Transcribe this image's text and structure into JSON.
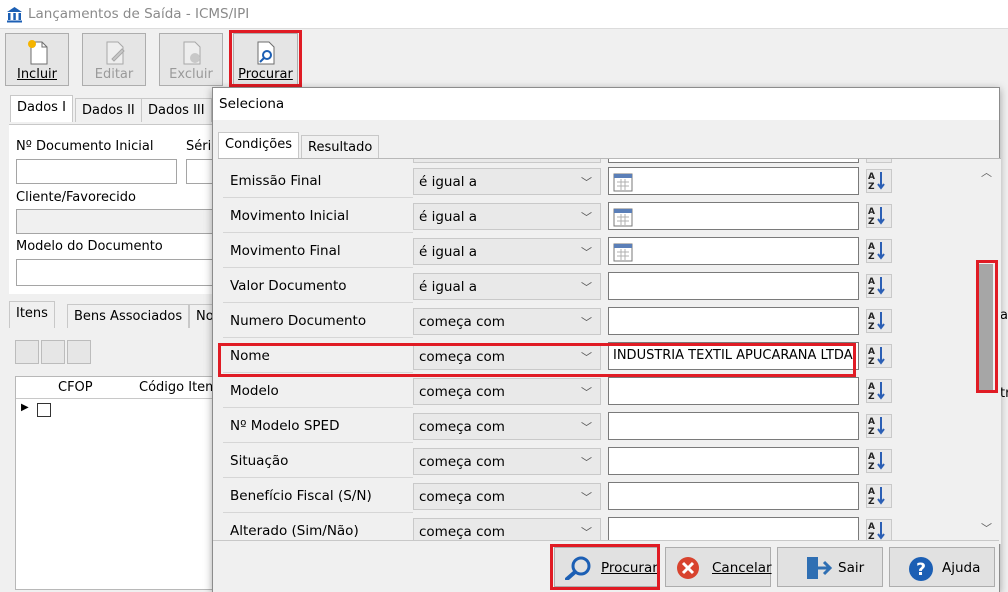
{
  "window": {
    "title": "Lançamentos de Saída - ICMS/IPI"
  },
  "toolbar": {
    "incluir": "Incluir",
    "editar": "Editar",
    "excluir": "Excluir",
    "procurar": "Procurar"
  },
  "tabs_top": [
    "Dados I",
    "Dados II",
    "Dados III"
  ],
  "form": {
    "doc_inicial_label": "Nº Documento Inicial",
    "serie_label": "Séri",
    "cliente_label": "Cliente/Favorecido",
    "modelo_label": "Modelo do Documento"
  },
  "tabs_bottom": [
    "Itens",
    "Bens Associados",
    "No"
  ],
  "items_table": {
    "col_cfop": "CFOP",
    "col_codigo": "Código Item",
    "right_label": "tr"
  },
  "right_tab_label": "ac",
  "dialog": {
    "title": "Seleciona",
    "tabs": [
      "Condições",
      "Resultado"
    ],
    "rows": [
      {
        "name": "Emissão Final",
        "cond": "é igual a",
        "value": "",
        "calendar": true
      },
      {
        "name": "Movimento Inicial",
        "cond": "é igual a",
        "value": "",
        "calendar": true
      },
      {
        "name": "Movimento Final",
        "cond": "é igual a",
        "value": "",
        "calendar": true
      },
      {
        "name": "Valor Documento",
        "cond": "é igual a",
        "value": "",
        "calendar": false
      },
      {
        "name": "Numero Documento",
        "cond": "começa com",
        "value": "",
        "calendar": false
      },
      {
        "name": "Nome",
        "cond": "começa com",
        "value": "INDUSTRIA TEXTIL APUCARANA LTDA.",
        "calendar": false
      },
      {
        "name": "Modelo",
        "cond": "começa com",
        "value": "",
        "calendar": false
      },
      {
        "name": "Nº Modelo SPED",
        "cond": "começa com",
        "value": "",
        "calendar": false
      },
      {
        "name": "Situação",
        "cond": "começa com",
        "value": "",
        "calendar": false
      },
      {
        "name": "Benefício Fiscal (S/N)",
        "cond": "começa com",
        "value": "",
        "calendar": false
      },
      {
        "name": "Alterado (Sim/Não)",
        "cond": "começa com",
        "value": "",
        "calendar": false
      }
    ],
    "buttons": {
      "procurar": "Procurar",
      "cancelar": "Cancelar",
      "sair": "Sair",
      "ajuda": "Ajuda"
    }
  },
  "colors": {
    "highlight": "#e01b24",
    "accent_blue": "#1c5fb4"
  }
}
